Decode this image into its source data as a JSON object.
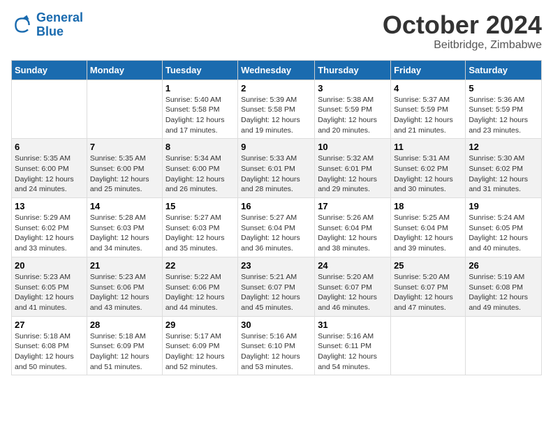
{
  "header": {
    "logo_line1": "General",
    "logo_line2": "Blue",
    "month": "October 2024",
    "location": "Beitbridge, Zimbabwe"
  },
  "columns": [
    "Sunday",
    "Monday",
    "Tuesday",
    "Wednesday",
    "Thursday",
    "Friday",
    "Saturday"
  ],
  "weeks": [
    [
      {
        "day": "",
        "empty": true
      },
      {
        "day": "",
        "empty": true
      },
      {
        "day": "1",
        "sunrise": "5:40 AM",
        "sunset": "5:58 PM",
        "daylight": "12 hours and 17 minutes."
      },
      {
        "day": "2",
        "sunrise": "5:39 AM",
        "sunset": "5:58 PM",
        "daylight": "12 hours and 19 minutes."
      },
      {
        "day": "3",
        "sunrise": "5:38 AM",
        "sunset": "5:59 PM",
        "daylight": "12 hours and 20 minutes."
      },
      {
        "day": "4",
        "sunrise": "5:37 AM",
        "sunset": "5:59 PM",
        "daylight": "12 hours and 21 minutes."
      },
      {
        "day": "5",
        "sunrise": "5:36 AM",
        "sunset": "5:59 PM",
        "daylight": "12 hours and 23 minutes."
      }
    ],
    [
      {
        "day": "6",
        "sunrise": "5:35 AM",
        "sunset": "6:00 PM",
        "daylight": "12 hours and 24 minutes."
      },
      {
        "day": "7",
        "sunrise": "5:35 AM",
        "sunset": "6:00 PM",
        "daylight": "12 hours and 25 minutes."
      },
      {
        "day": "8",
        "sunrise": "5:34 AM",
        "sunset": "6:00 PM",
        "daylight": "12 hours and 26 minutes."
      },
      {
        "day": "9",
        "sunrise": "5:33 AM",
        "sunset": "6:01 PM",
        "daylight": "12 hours and 28 minutes."
      },
      {
        "day": "10",
        "sunrise": "5:32 AM",
        "sunset": "6:01 PM",
        "daylight": "12 hours and 29 minutes."
      },
      {
        "day": "11",
        "sunrise": "5:31 AM",
        "sunset": "6:02 PM",
        "daylight": "12 hours and 30 minutes."
      },
      {
        "day": "12",
        "sunrise": "5:30 AM",
        "sunset": "6:02 PM",
        "daylight": "12 hours and 31 minutes."
      }
    ],
    [
      {
        "day": "13",
        "sunrise": "5:29 AM",
        "sunset": "6:02 PM",
        "daylight": "12 hours and 33 minutes."
      },
      {
        "day": "14",
        "sunrise": "5:28 AM",
        "sunset": "6:03 PM",
        "daylight": "12 hours and 34 minutes."
      },
      {
        "day": "15",
        "sunrise": "5:27 AM",
        "sunset": "6:03 PM",
        "daylight": "12 hours and 35 minutes."
      },
      {
        "day": "16",
        "sunrise": "5:27 AM",
        "sunset": "6:04 PM",
        "daylight": "12 hours and 36 minutes."
      },
      {
        "day": "17",
        "sunrise": "5:26 AM",
        "sunset": "6:04 PM",
        "daylight": "12 hours and 38 minutes."
      },
      {
        "day": "18",
        "sunrise": "5:25 AM",
        "sunset": "6:04 PM",
        "daylight": "12 hours and 39 minutes."
      },
      {
        "day": "19",
        "sunrise": "5:24 AM",
        "sunset": "6:05 PM",
        "daylight": "12 hours and 40 minutes."
      }
    ],
    [
      {
        "day": "20",
        "sunrise": "5:23 AM",
        "sunset": "6:05 PM",
        "daylight": "12 hours and 41 minutes."
      },
      {
        "day": "21",
        "sunrise": "5:23 AM",
        "sunset": "6:06 PM",
        "daylight": "12 hours and 43 minutes."
      },
      {
        "day": "22",
        "sunrise": "5:22 AM",
        "sunset": "6:06 PM",
        "daylight": "12 hours and 44 minutes."
      },
      {
        "day": "23",
        "sunrise": "5:21 AM",
        "sunset": "6:07 PM",
        "daylight": "12 hours and 45 minutes."
      },
      {
        "day": "24",
        "sunrise": "5:20 AM",
        "sunset": "6:07 PM",
        "daylight": "12 hours and 46 minutes."
      },
      {
        "day": "25",
        "sunrise": "5:20 AM",
        "sunset": "6:07 PM",
        "daylight": "12 hours and 47 minutes."
      },
      {
        "day": "26",
        "sunrise": "5:19 AM",
        "sunset": "6:08 PM",
        "daylight": "12 hours and 49 minutes."
      }
    ],
    [
      {
        "day": "27",
        "sunrise": "5:18 AM",
        "sunset": "6:08 PM",
        "daylight": "12 hours and 50 minutes."
      },
      {
        "day": "28",
        "sunrise": "5:18 AM",
        "sunset": "6:09 PM",
        "daylight": "12 hours and 51 minutes."
      },
      {
        "day": "29",
        "sunrise": "5:17 AM",
        "sunset": "6:09 PM",
        "daylight": "12 hours and 52 minutes."
      },
      {
        "day": "30",
        "sunrise": "5:16 AM",
        "sunset": "6:10 PM",
        "daylight": "12 hours and 53 minutes."
      },
      {
        "day": "31",
        "sunrise": "5:16 AM",
        "sunset": "6:11 PM",
        "daylight": "12 hours and 54 minutes."
      },
      {
        "day": "",
        "empty": true
      },
      {
        "day": "",
        "empty": true
      }
    ]
  ],
  "daylight_label": "Daylight:",
  "sunrise_label": "Sunrise:",
  "sunset_label": "Sunset:"
}
